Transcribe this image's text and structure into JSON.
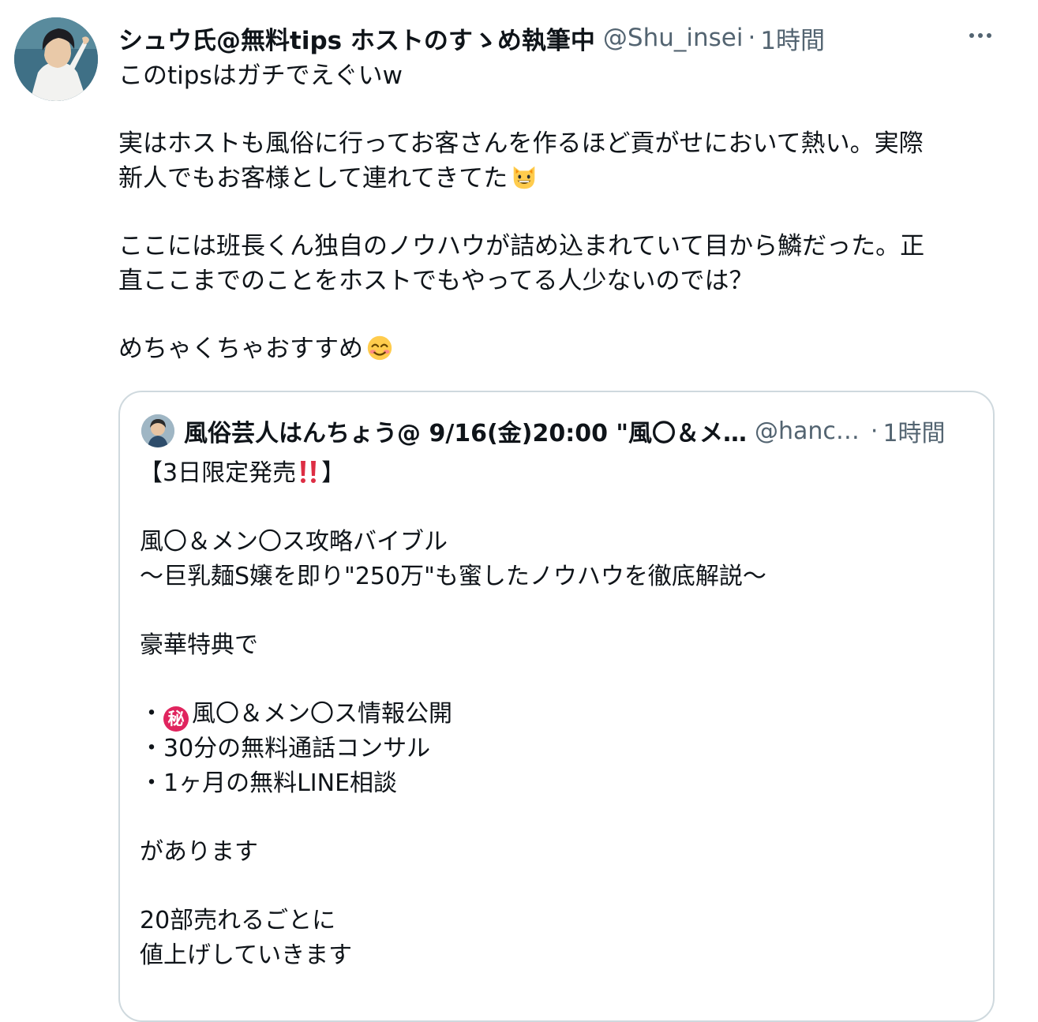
{
  "tweet": {
    "display_name": "シュウ氏@無料tips ホストのすゝめ執筆中",
    "handle": "@Shu_insei",
    "separator": "·",
    "time": "1時間",
    "more_label": "…",
    "lines": [
      "このtipsはガチでえぐいw",
      "実はホストも風俗に行ってお客さんを作るほど貢がせにおいて熱い。実際",
      "新人でもお客様として連れてきてた",
      "ここには班長くん独自のノウハウが詰め込まれていて目から鱗だった。正",
      "直ここまでのことをホストでもやってる人少ないのでは？",
      "めちゃくちゃおすすめ"
    ],
    "emojis": [
      "grinning-cat-emoji",
      "smiling-face-emoji"
    ]
  },
  "quote": {
    "display_name": "風俗芸人はんちょう@ 9/16(金)20:00 \"風〇＆メ…",
    "handle": "@hanc…",
    "separator": "·",
    "time": "1時間",
    "lines": {
      "l1a": "【3日限定発売",
      "l1b": "】",
      "l2": "風〇＆メン〇ス攻略バイブル",
      "l3": "〜巨乳麺S嬢を即り\"250万\"も蜜したノウハウを徹底解説〜",
      "l4": "豪華特典で",
      "l5a": "・",
      "l5badge": "秘",
      "l5b": "風〇＆メン〇ス情報公開",
      "l6": "・30分の無料通話コンサル",
      "l7": "・1ヶ月の無料LINE相談",
      "l8": "があります",
      "l9": "20部売れるごとに",
      "l10": "値上げしていきます"
    },
    "icons": [
      "double-exclamation-icon"
    ]
  },
  "colors": {
    "text": "#0f1419",
    "secondary": "#536471",
    "border": "#cfd9de",
    "badge": "#e0245e"
  }
}
